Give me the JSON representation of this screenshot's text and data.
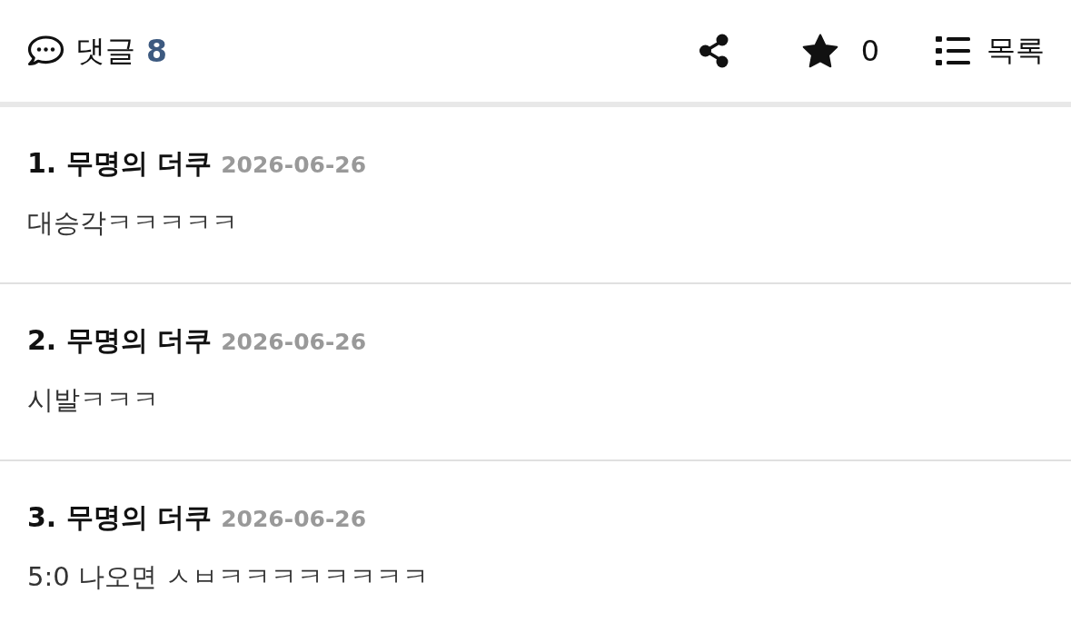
{
  "header": {
    "comments_label": "댓글",
    "comment_count": "8",
    "star_count": "0",
    "list_label": "목록"
  },
  "comments": [
    {
      "title": "1. 무명의 더쿠",
      "date": "2026-06-26",
      "body": "대승각ㅋㅋㅋㅋㅋ"
    },
    {
      "title": "2. 무명의 더쿠",
      "date": "2026-06-26",
      "body": "시발ㅋㅋㅋ"
    },
    {
      "title": "3. 무명의 더쿠",
      "date": "2026-06-26",
      "body": "5:0 나오면 ㅅㅂㅋㅋㅋㅋㅋㅋㅋㅋ"
    }
  ]
}
